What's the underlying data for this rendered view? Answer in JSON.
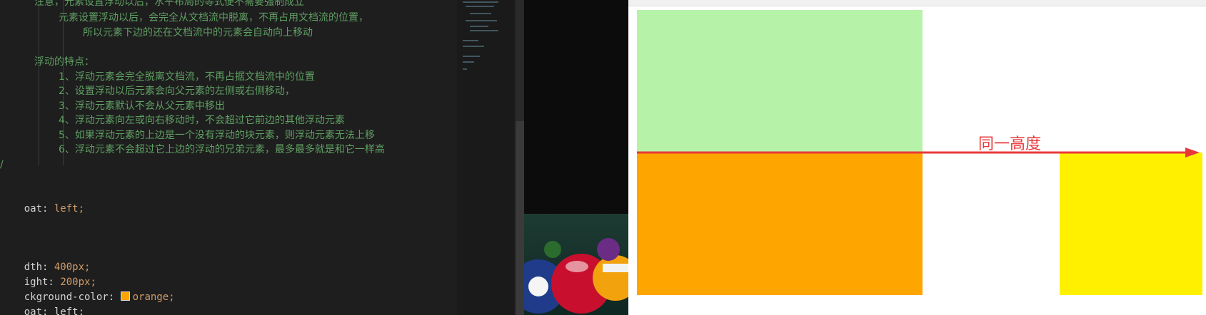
{
  "editor": {
    "comment_lines": [
      "注意，元素设置浮动以后，水平布局的等式便不需要强制成立",
      "元素设置浮动以后，会完全从文档流中脱离，不再占用文档流的位置，",
      "所以元素下边的还在文档流中的元素会自动向上移动",
      "浮动的特点：",
      "1、浮动元素会完全脱离文档流，不再占据文档流中的位置",
      "2、设置浮动以后元素会向父元素的左侧或右侧移动，",
      "3、浮动元素默认不会从父元素中移出",
      "4、浮动元素向左或向右移动时，不会超过它前边的其他浮动元素",
      "5、如果浮动元素的上边是一个没有浮动的块元素，则浮动元素无法上移",
      "6、浮动元素不会超过它上边的浮动的兄弟元素，最多最多就是和它一样高"
    ],
    "comment_close": "/",
    "code": {
      "float_prop": "oat:",
      "float_val": "left;",
      "width_prop": "dth:",
      "width_val": "400px;",
      "height_prop": "ight:",
      "height_val": "200px;",
      "bg_prop": "ckground-color:",
      "bg_val": "orange;",
      "last_partial": "oat: left;"
    },
    "colors": {
      "comment": "#5f9f62",
      "value": "#cf9b6a",
      "swatch": "#ffa500"
    }
  },
  "browser": {
    "annotation": "同一高度",
    "colors": {
      "box1": "#b6f2a8",
      "box2": "#ffa500",
      "box3": "#fff000",
      "annotation": "#e8393a"
    }
  }
}
